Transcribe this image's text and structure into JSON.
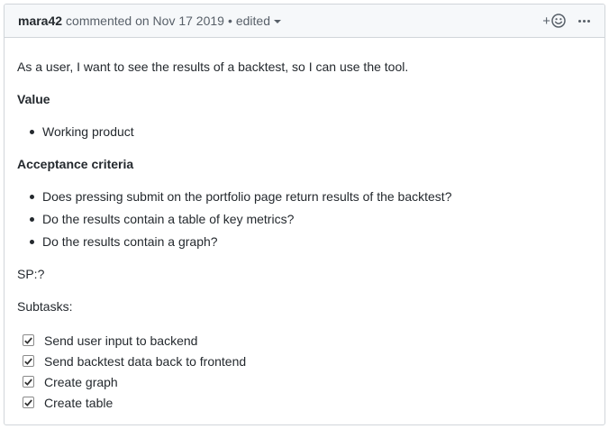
{
  "header": {
    "author": "mara42",
    "action": "commented on Nov 17 2019",
    "separator": "•",
    "edited": "edited"
  },
  "body": {
    "intro": "As a user, I want to see the results of a backtest, so I can use the tool.",
    "value_heading": "Value",
    "value_items": [
      "Working product"
    ],
    "criteria_heading": "Acceptance criteria",
    "criteria_items": [
      "Does pressing submit on the portfolio page return results of the backtest?",
      "Do the results contain a table of key metrics?",
      "Do the results contain a graph?"
    ],
    "sp": "SP:?",
    "subtasks_label": "Subtasks:",
    "tasks": [
      {
        "label": "Send user input to backend",
        "checked": true
      },
      {
        "label": "Send backtest data back to frontend",
        "checked": true
      },
      {
        "label": "Create graph",
        "checked": true
      },
      {
        "label": "Create table",
        "checked": true
      }
    ]
  },
  "colors": {
    "border": "#d1d5da",
    "header_bg": "#f6f8fa",
    "muted": "#586069",
    "text": "#24292e"
  },
  "icons": {
    "reaction": "smiley-plus-icon",
    "more": "kebab-icon",
    "task": "checkbox-checked-icon"
  }
}
